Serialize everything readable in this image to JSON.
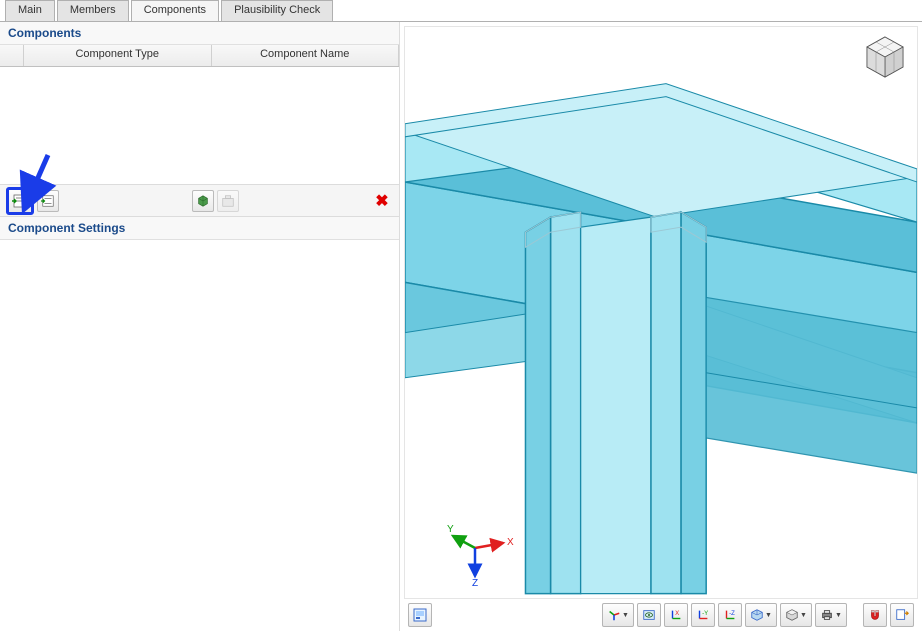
{
  "tabs": {
    "main": "Main",
    "members": "Members",
    "components": "Components",
    "plausibility": "Plausibility Check"
  },
  "panel": {
    "components_title": "Components",
    "col_type": "Component Type",
    "col_name": "Component Name",
    "settings_title": "Component Settings"
  },
  "axis": {
    "x": "X",
    "y": "Y",
    "z": "Z"
  }
}
